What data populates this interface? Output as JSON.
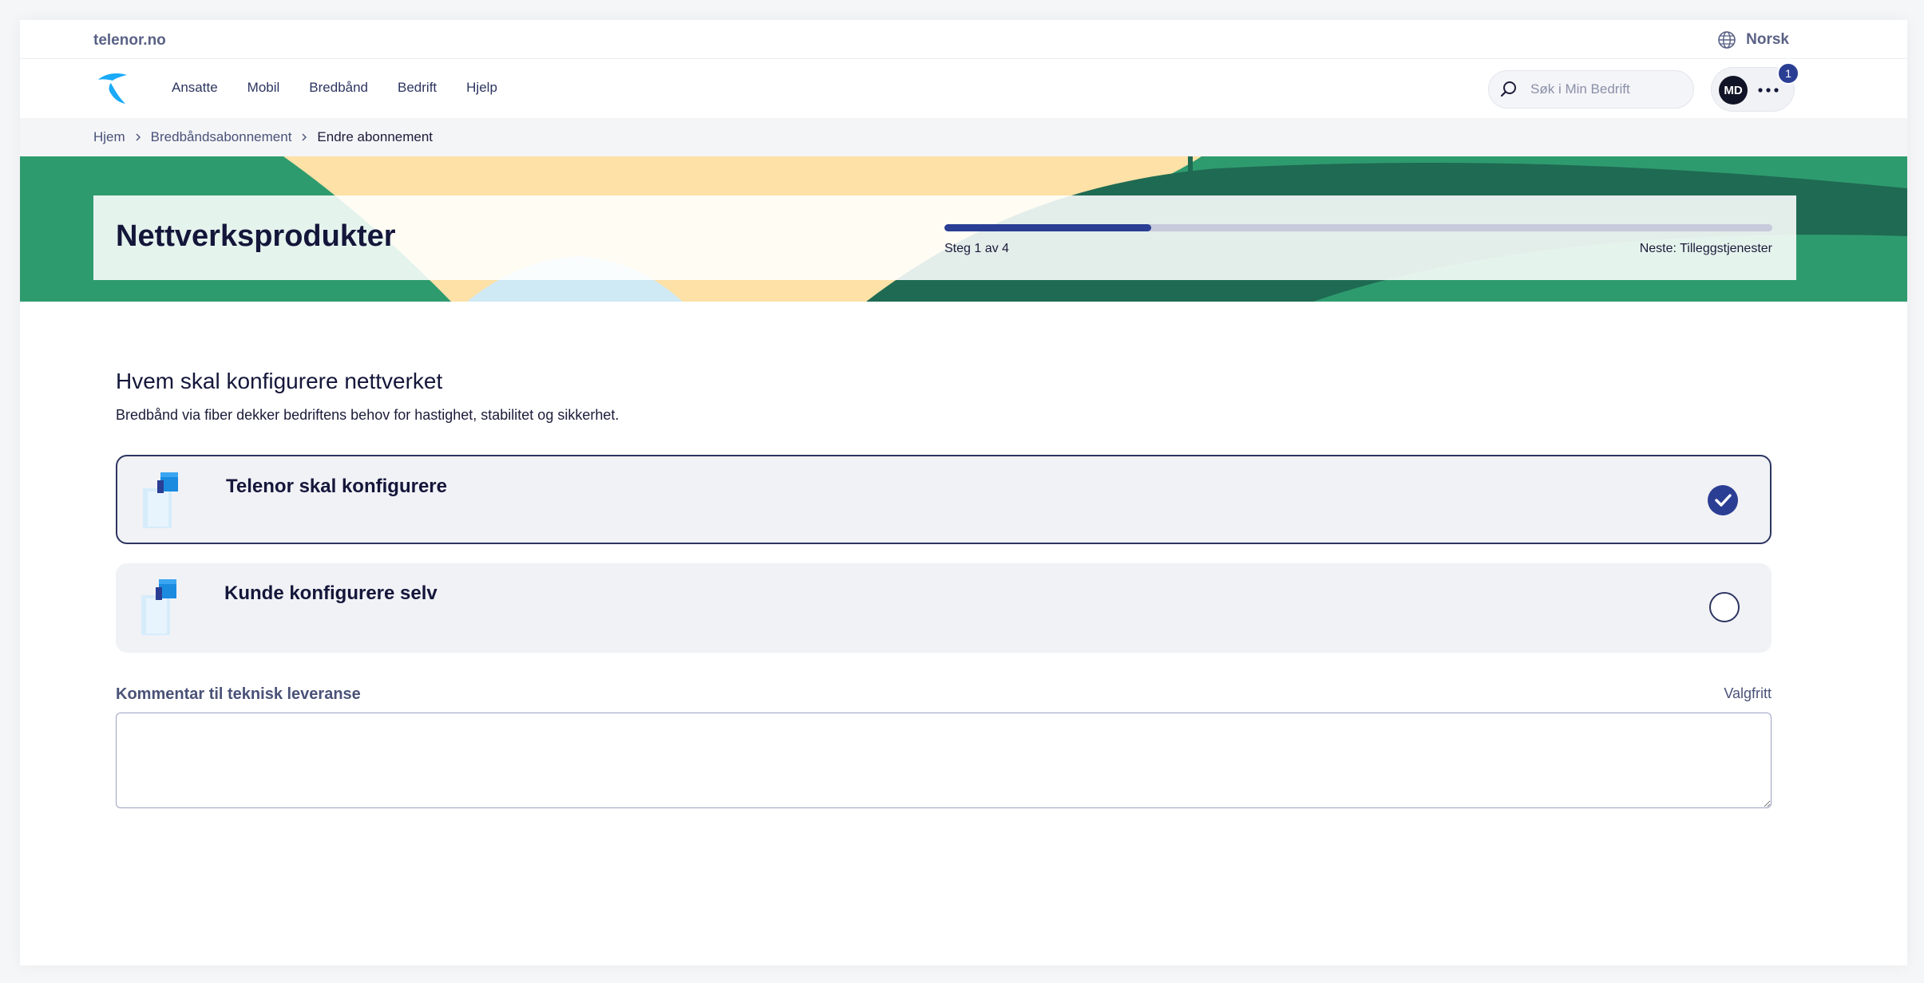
{
  "topbar": {
    "site_link": "telenor.no",
    "language": "Norsk"
  },
  "nav": {
    "links": [
      "Ansatte",
      "Mobil",
      "Bredbånd",
      "Bedrift",
      "Hjelp"
    ],
    "search_placeholder": "Søk i Min Bedrift",
    "user_initials": "MD",
    "notification_count": "1"
  },
  "breadcrumb": [
    "Hjem",
    "Bredbåndsabonnement",
    "Endre abonnement"
  ],
  "hero": {
    "title": "Nettverksprodukter",
    "step_text": "Steg 1 av 4",
    "next_text": "Neste: Tilleggstjenester",
    "progress_fraction": 0.25
  },
  "section": {
    "title": "Hvem skal konfigurere nettverket",
    "description": "Bredbånd via fiber dekker bedriftens behov for hastighet, stabilitet og sikkerhet."
  },
  "options": [
    {
      "label": "Telenor skal konfigurere",
      "selected": true
    },
    {
      "label": "Kunde konfigurere selv",
      "selected": false
    }
  ],
  "comment": {
    "label": "Kommentar til teknisk leveranse",
    "optional": "Valgfritt",
    "value": ""
  },
  "colors": {
    "accent": "#2a3e94",
    "hero_green": "#2e9b6f",
    "hero_dark_green": "#1f6a52",
    "hero_sand": "#fde1a6",
    "logo_blue": "#19aaf8"
  }
}
